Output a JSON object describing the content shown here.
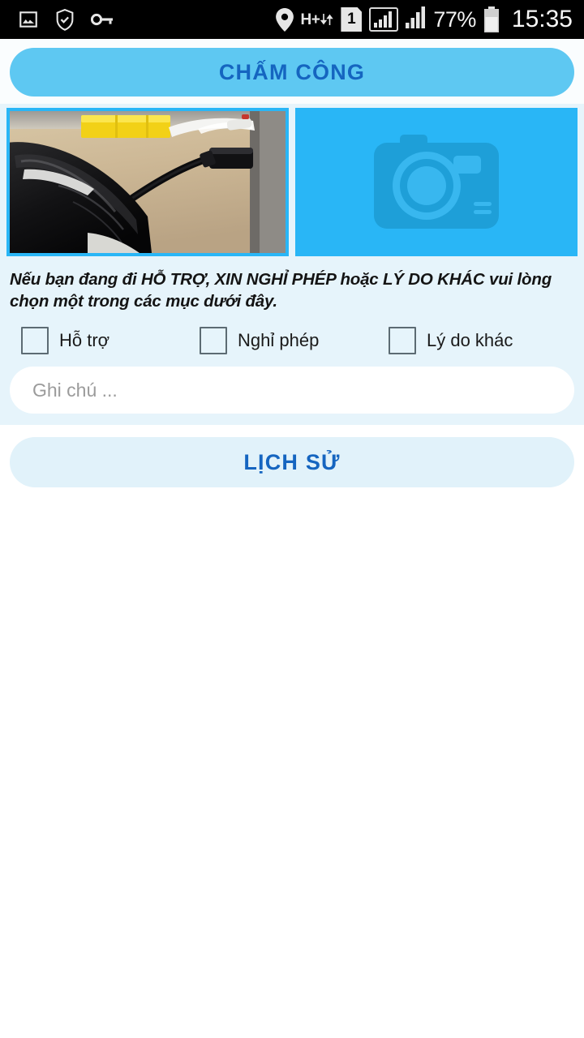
{
  "statusbar": {
    "left_icons": [
      {
        "name": "gallery-icon"
      },
      {
        "name": "shield-check-icon"
      },
      {
        "name": "key-icon"
      }
    ],
    "right_icons": [
      {
        "name": "location-pin-icon"
      },
      {
        "name": "hplus-data-icon",
        "label": "H+"
      },
      {
        "name": "sim-1-icon",
        "label": "1"
      },
      {
        "name": "signal-bars-boxed-icon"
      },
      {
        "name": "signal-bars-icon"
      }
    ],
    "battery_percent": "77%",
    "battery_icon": "battery-icon",
    "clock": "15:35"
  },
  "header": {
    "checkin_label": "CHẤM CÔNG"
  },
  "capture": {
    "photo_name": "captured-photo-thumbnail",
    "photo_alt": "Ảnh chụp điện thoại và cáp trên bàn gỗ",
    "placeholder_icon": "camera-icon"
  },
  "form": {
    "instructions": "Nếu bạn đang đi HỖ TRỢ, XIN NGHỈ PHÉP hoặc LÝ DO KHÁC vui lòng chọn một trong các mục dưới đây.",
    "checkboxes": [
      {
        "label": "Hỗ trợ",
        "checked": false
      },
      {
        "label": "Nghỉ phép",
        "checked": false
      },
      {
        "label": "Lý do khác",
        "checked": false
      }
    ],
    "note": {
      "value": "",
      "placeholder": "Ghi chú ..."
    }
  },
  "footer": {
    "history_label": "LỊCH SỬ"
  },
  "colors": {
    "accent_bright": "#29b6f6",
    "primary_button": "#5ec8f2",
    "secondary_button": "#e1f2fa",
    "panel_bg": "#e6f4fb",
    "text_blue": "#1565c0",
    "statusbar_bg": "#000000"
  }
}
